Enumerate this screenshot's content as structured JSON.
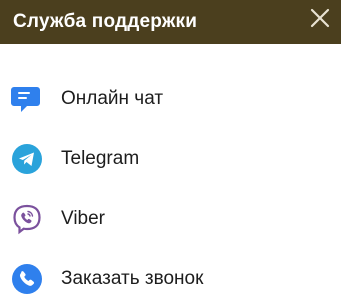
{
  "header": {
    "title": "Служба поддержки",
    "close_icon": "close-icon"
  },
  "items": [
    {
      "label": "Онлайн чат",
      "icon": "chat-bubble-icon",
      "color": "#2f80ed"
    },
    {
      "label": "Telegram",
      "icon": "telegram-icon",
      "color": "#2aa3db"
    },
    {
      "label": "Viber",
      "icon": "viber-icon",
      "color": "#7b519d"
    },
    {
      "label": "Заказать звонок",
      "icon": "phone-icon",
      "color": "#2f80ed"
    }
  ],
  "colors": {
    "header_bg": "#4b3f1e",
    "header_text": "#ffffff",
    "text": "#1d1d1d"
  }
}
